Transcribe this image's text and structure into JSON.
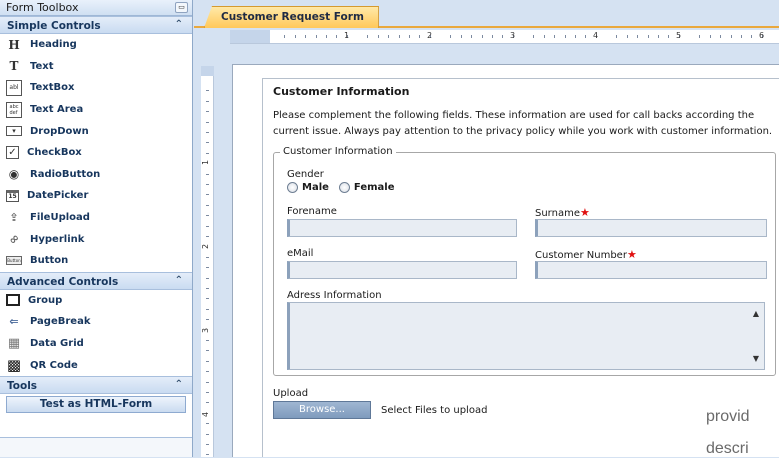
{
  "toolbox": {
    "title": "Form Toolbox",
    "minimize_icon": "minimize-icon",
    "sections": {
      "simple": {
        "label": "Simple Controls",
        "items": [
          {
            "label": "Heading",
            "icon": "heading-icon",
            "glyph": "H"
          },
          {
            "label": "Text",
            "icon": "text-icon",
            "glyph": "T"
          },
          {
            "label": "TextBox",
            "icon": "textbox-icon",
            "glyph": "abl"
          },
          {
            "label": "Text Area",
            "icon": "textarea-icon",
            "glyph": "abc"
          },
          {
            "label": "DropDown",
            "icon": "dropdown-icon",
            "glyph": "▾"
          },
          {
            "label": "CheckBox",
            "icon": "checkbox-icon",
            "glyph": "✓"
          },
          {
            "label": "RadioButton",
            "icon": "radiobutton-icon",
            "glyph": "◉"
          },
          {
            "label": "DatePicker",
            "icon": "datepicker-icon",
            "glyph": "15"
          },
          {
            "label": "FileUpload",
            "icon": "fileupload-icon",
            "glyph": "⇪"
          },
          {
            "label": "Hyperlink",
            "icon": "hyperlink-icon",
            "glyph": "∞"
          },
          {
            "label": "Button",
            "icon": "button-icon",
            "glyph": "▭"
          }
        ]
      },
      "advanced": {
        "label": "Advanced Controls",
        "items": [
          {
            "label": "Group",
            "icon": "group-icon",
            "glyph": "▢"
          },
          {
            "label": "PageBreak",
            "icon": "pagebreak-icon",
            "glyph": "⇐"
          },
          {
            "label": "Data Grid",
            "icon": "datagrid-icon",
            "glyph": "▦"
          },
          {
            "label": "QR Code",
            "icon": "qrcode-icon",
            "glyph": "▩"
          }
        ]
      },
      "tools": {
        "label": "Tools",
        "test_button": "Test as HTML-Form"
      }
    }
  },
  "tab": {
    "label": "Customer Request Form"
  },
  "rulers": {
    "horizontal": [
      "1",
      "2",
      "3",
      "4",
      "5",
      "6"
    ],
    "vertical": [
      "1",
      "2",
      "3",
      "4"
    ]
  },
  "form": {
    "title": "Customer Information",
    "description": "Please complement the following fields. These information are used for call backs according the current issue. Always pay attention to the privacy policy while you work with customer information.",
    "group_legend": "Customer Information",
    "gender_label": "Gender",
    "gender_options": [
      "Male",
      "Female"
    ],
    "forename_label": "Forename",
    "surname_label": "Surname",
    "email_label": "eMail",
    "customer_number_label": "Customer Number",
    "required_marker": "★",
    "address_label": "Adress Information",
    "upload_label": "Upload",
    "browse_button": "Browse...",
    "upload_hint": "Select Files to upload"
  },
  "overflow_text": [
    "provid",
    "descri"
  ]
}
